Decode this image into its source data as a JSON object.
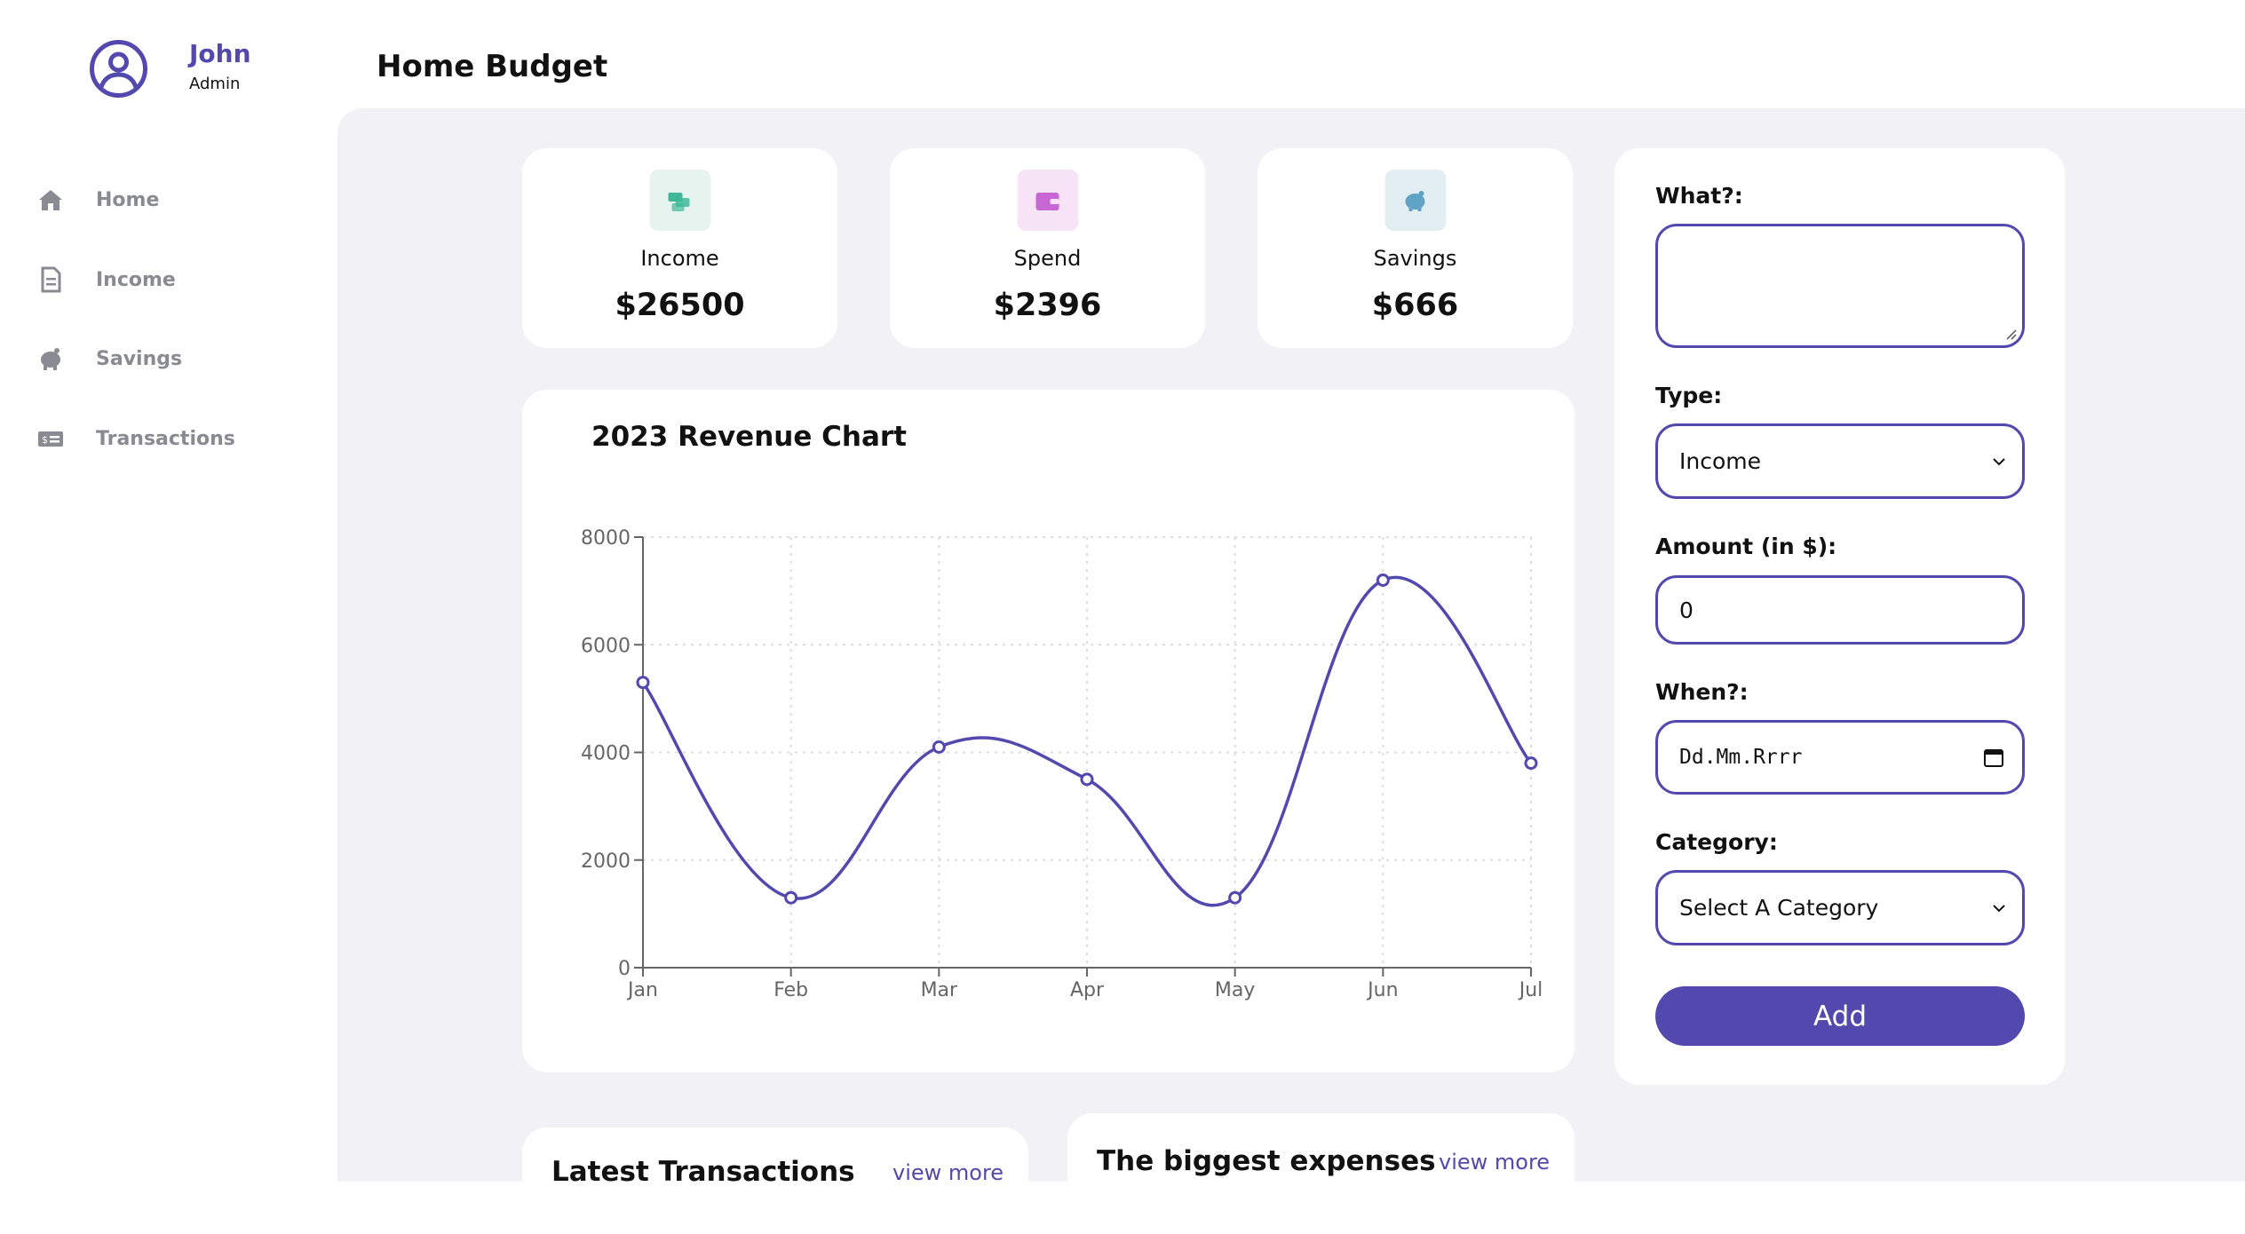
{
  "user": {
    "name": "John",
    "role": "Admin"
  },
  "page_title": "Home Budget",
  "sidebar": {
    "items": [
      {
        "label": "Home",
        "icon": "home-icon"
      },
      {
        "label": "Income",
        "icon": "document-icon"
      },
      {
        "label": "Savings",
        "icon": "piggy-bank-icon"
      },
      {
        "label": "Transactions",
        "icon": "money-card-icon"
      }
    ]
  },
  "stats": [
    {
      "label": "Income",
      "value": "$26500",
      "icon": "money-icon",
      "icon_bg": "#e6f3ef",
      "icon_color": "#3fb89a"
    },
    {
      "label": "Spend",
      "value": "$2396",
      "icon": "wallet-icon",
      "icon_bg": "#f7e3f6",
      "icon_color": "#c966d6"
    },
    {
      "label": "Savings",
      "value": "$666",
      "icon": "piggy-bank-icon",
      "icon_bg": "#e3eef3",
      "icon_color": "#5fa3c6"
    }
  ],
  "chart_data": {
    "type": "line",
    "title": "2023 Revenue Chart",
    "categories": [
      "Jan",
      "Feb",
      "Mar",
      "Apr",
      "May",
      "Jun",
      "Jul"
    ],
    "series": [
      {
        "values": [
          5300,
          1300,
          4100,
          3500,
          1300,
          7200,
          3800
        ],
        "color": "#5248ad"
      }
    ],
    "y_ticks": [
      "0",
      "2000",
      "4000",
      "6000",
      "8000"
    ],
    "ylim": [
      0,
      8000
    ],
    "grid": true,
    "smooth": true
  },
  "form": {
    "what_label": "What?:",
    "what_value": "",
    "type_label": "Type:",
    "type_value": "Income",
    "amount_label": "Amount (in $):",
    "amount_value": "0",
    "when_label": "When?:",
    "when_placeholder": "Dd.Mm.Rrrr",
    "category_label": "Category:",
    "category_value": "Select A Category",
    "add_label": "Add"
  },
  "latest_transactions": {
    "title": "Latest Transactions",
    "view_more": "view more"
  },
  "biggest_expenses": {
    "title": "The biggest expenses",
    "view_more": "view more"
  },
  "colors": {
    "accent": "#5248ad",
    "background": "#f2f2f6",
    "muted": "#8a8a93"
  }
}
